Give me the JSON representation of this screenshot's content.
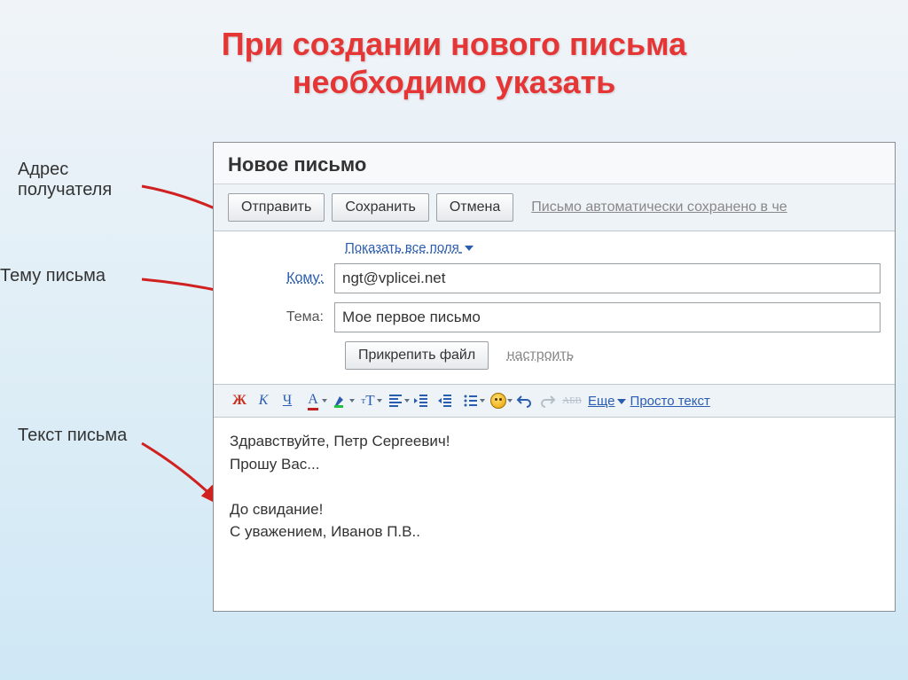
{
  "slide": {
    "title_line1": "При создании нового письма",
    "title_line2": "необходимо указать"
  },
  "labels": {
    "recipient": "Адрес\nполучателя",
    "subject": "Тему письма",
    "body": "Текст письма"
  },
  "compose": {
    "window_title": "Новое письмо",
    "toolbar": {
      "send": "Отправить",
      "save": "Сохранить",
      "cancel": "Отмена",
      "autosave": "Письмо автоматически сохранено в че"
    },
    "fields": {
      "show_all": "Показать все поля",
      "to_label": "Кому:",
      "to_value": "ngt@vplicei.net",
      "subject_label": "Тема:",
      "subject_value": "Мое первое письмо",
      "attach": "Прикрепить файл",
      "configure": "настроить"
    },
    "format": {
      "bold": "Ж",
      "italic": "К",
      "underline": "Ч",
      "font_color": "А",
      "more": "Еще",
      "plain": "Просто текст"
    },
    "body_text": "Здравствуйте, Петр Сергеевич!\nПрошу Вас...\n\nДо свидание!\nС уважением, Иванов П.В.."
  }
}
